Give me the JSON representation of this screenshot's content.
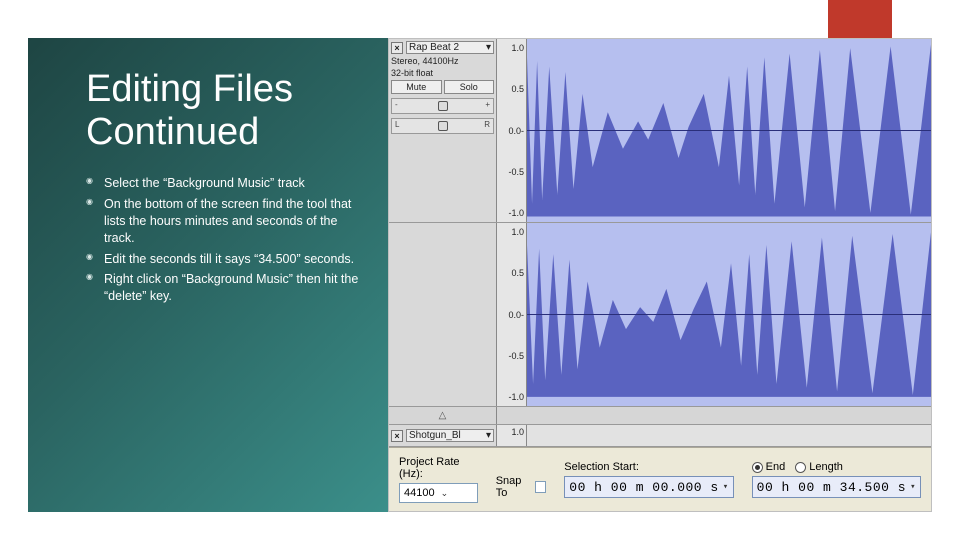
{
  "slide": {
    "title": "Editing Files Continued",
    "bullets": [
      "Select the “Background Music” track",
      "On the bottom of the screen find the tool that lists the hours minutes and seconds of the track.",
      "Edit the seconds till it says “34.500” seconds.",
      "Right click on “Background Music” then hit the “delete” key."
    ]
  },
  "track1": {
    "name": "Rap Beat 2",
    "hz": "Stereo, 44100Hz",
    "format": "32-bit float",
    "mute": "Mute",
    "solo": "Solo",
    "pan_l": "L",
    "pan_r": "R",
    "gain_minus": "-",
    "gain_plus": "+",
    "ruler1": [
      "1.0",
      "0.5",
      "0.0-",
      "-0.5",
      "-1.0"
    ],
    "ruler2": [
      "1.0",
      "0.5",
      "0.0-",
      "-0.5",
      "-1.0"
    ]
  },
  "track2": {
    "name": "Shotgun_Bl",
    "ruler": "1.0"
  },
  "toolbar": {
    "rate_label": "Project Rate (Hz):",
    "rate_value": "44100",
    "snap_label": "Snap To",
    "sel_start_label": "Selection Start:",
    "sel_start_value": "00 h 00 m 00.000 s",
    "end_label": "End",
    "length_label": "Length",
    "end_value": "00 h 00 m 34.500 s"
  }
}
